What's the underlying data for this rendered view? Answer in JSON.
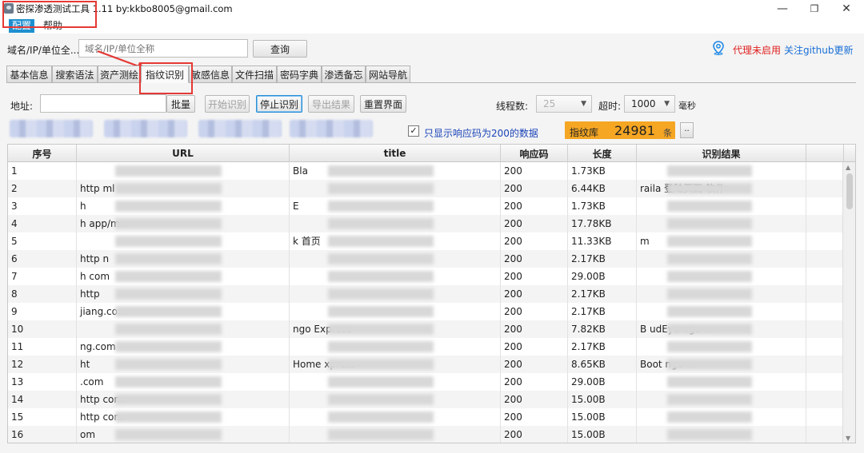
{
  "window": {
    "title": "密探渗透测试工具 1.11 by:kkbo8005@gmail.com",
    "minimize": "—",
    "maximize": "❐",
    "close": "✕"
  },
  "menu": {
    "config": "配置",
    "help": "帮助"
  },
  "search": {
    "label": "域名/IP/单位全...",
    "placeholder": "域名/IP/单位全称",
    "query_button": "查询"
  },
  "proxy": {
    "status": "代理未启用",
    "github_link": "关注github更新"
  },
  "tabs": [
    "基本信息",
    "搜索语法",
    "资产测绘",
    "指纹识别",
    "敏感信息",
    "文件扫描",
    "密码字典",
    "渗透备忘",
    "网站导航"
  ],
  "selected_tab": "指纹识别",
  "fingerprint": {
    "address_label": "地址:",
    "batch_button": "批量",
    "start_button": "开始识别",
    "stop_button": "停止识别",
    "export_button": "导出结果",
    "reset_button": "重置界面",
    "threads_label": "线程数:",
    "threads_value": "25",
    "timeout_label": "超时:",
    "timeout_value": "1000",
    "timeout_unit": "毫秒",
    "only200_checked": true,
    "only200_label": "只显示响应码为200的数据",
    "library_label": "指纹库",
    "library_count": "24981",
    "library_unit": "条",
    "more_button": ".."
  },
  "table": {
    "headers": [
      "序号",
      "URL",
      "title",
      "响应码",
      "长度",
      "识别结果"
    ],
    "rows": [
      {
        "no": "1",
        "url": "",
        "title": "Bla",
        "code": "200",
        "length": "1.73KB",
        "result": ""
      },
      {
        "no": "2",
        "url": "http                                  ml",
        "title": "",
        "code": "200",
        "length": "6.44KB",
        "result": "raila              登陆页面    软件"
      },
      {
        "no": "3",
        "url": "h",
        "title": "E",
        "code": "200",
        "length": "1.73KB",
        "result": ""
      },
      {
        "no": "4",
        "url": "h                                  app/m...",
        "title": "",
        "code": "200",
        "length": "17.78KB",
        "result": ""
      },
      {
        "no": "5",
        "url": "",
        "title": "k                    首页",
        "code": "200",
        "length": "11.33KB",
        "result": "                           m"
      },
      {
        "no": "6",
        "url": "http                               n",
        "title": "",
        "code": "200",
        "length": "2.17KB",
        "result": ""
      },
      {
        "no": "7",
        "url": "h                                  com",
        "title": "",
        "code": "200",
        "length": "29.00B",
        "result": ""
      },
      {
        "no": "8",
        "url": "http",
        "title": "",
        "code": "200",
        "length": "2.17KB",
        "result": ""
      },
      {
        "no": "9",
        "url": "                               jiang.com",
        "title": "",
        "code": "200",
        "length": "2.17KB",
        "result": ""
      },
      {
        "no": "10",
        "url": "",
        "title": "               ngo Express",
        "code": "200",
        "length": "7.82KB",
        "result": "B                         udEye       ngo-..."
      },
      {
        "no": "11",
        "url": "                              ng.com",
        "title": "",
        "code": "200",
        "length": "2.17KB",
        "result": ""
      },
      {
        "no": "12",
        "url": "ht",
        "title": "Home                xpress",
        "code": "200",
        "length": "8.65KB",
        "result": "Boot                               ngo-..."
      },
      {
        "no": "13",
        "url": "                             .com",
        "title": "",
        "code": "200",
        "length": "29.00B",
        "result": ""
      },
      {
        "no": "14",
        "url": "http                             com",
        "title": "",
        "code": "200",
        "length": "15.00B",
        "result": ""
      },
      {
        "no": "15",
        "url": "http                             com",
        "title": "",
        "code": "200",
        "length": "15.00B",
        "result": ""
      },
      {
        "no": "16",
        "url": "                                 om",
        "title": "",
        "code": "200",
        "length": "15.00B",
        "result": ""
      }
    ]
  }
}
